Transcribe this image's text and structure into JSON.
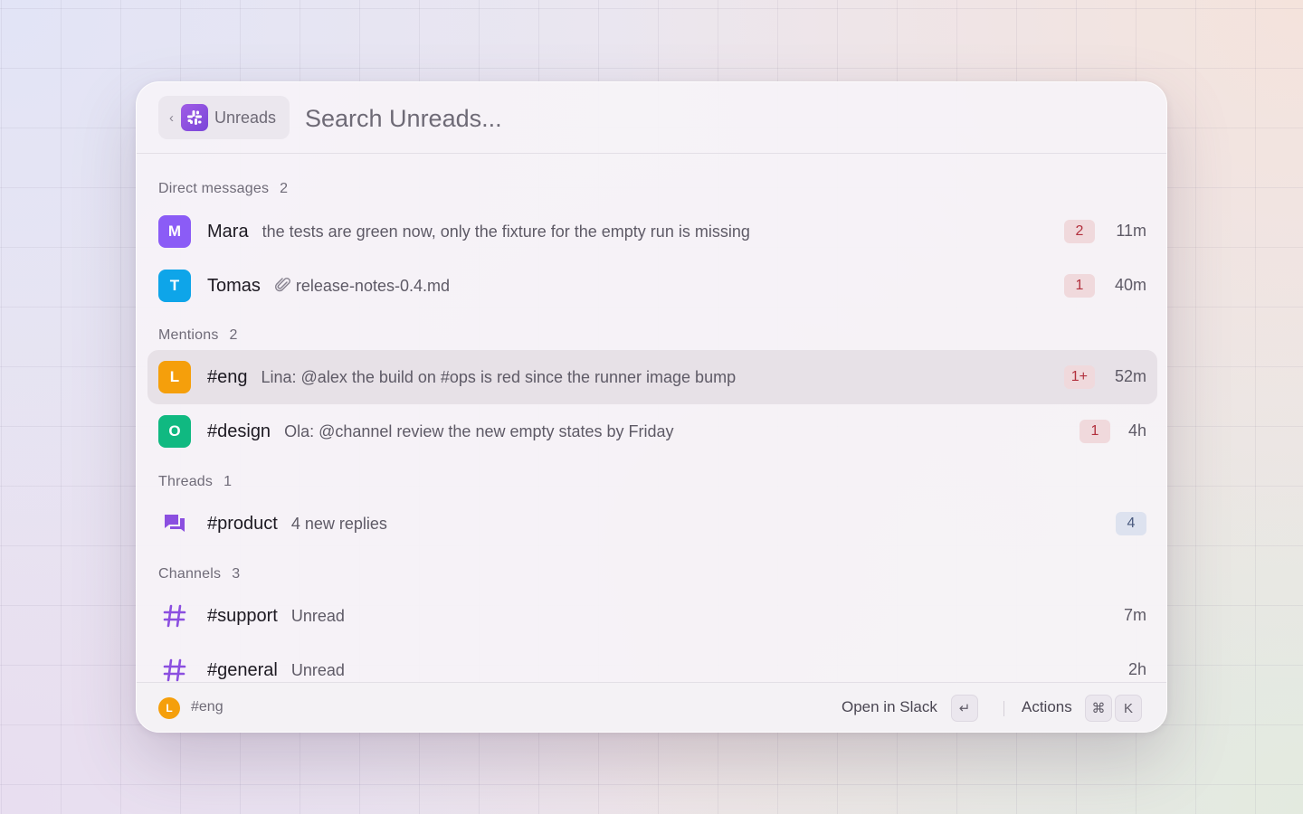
{
  "header": {
    "back_chevron": "‹",
    "context_label": "Unreads",
    "app_icon": "slack-logo",
    "search_placeholder": "Search Unreads..."
  },
  "sections": {
    "direct": {
      "label": "Direct messages",
      "count": "2"
    },
    "mentions": {
      "label": "Mentions",
      "count": "2"
    },
    "threads": {
      "label": "Threads",
      "count": "1"
    },
    "channels": {
      "label": "Channels",
      "count": "3"
    }
  },
  "rows": {
    "mara": {
      "initial": "M",
      "color": "#8b5cf6",
      "title": "Mara",
      "subtitle": "the tests are green now, only the fixture for the empty run is missing",
      "badge": "2",
      "time": "11m"
    },
    "tomas": {
      "initial": "T",
      "color": "#0ea5e9",
      "title": "Tomas",
      "icon": "paperclip-icon",
      "subtitle": "release-notes-0.4.md",
      "badge": "1",
      "time": "40m"
    },
    "eng": {
      "initial": "L",
      "color": "#f59f0b",
      "title": "#eng",
      "subtitle": "Lina: @alex the build on #ops is red since the runner image bump",
      "badge": "1+",
      "time": "52m"
    },
    "design": {
      "initial": "O",
      "color": "#10b981",
      "title": "#design",
      "subtitle": "Ola: @channel review the new empty states by Friday",
      "badge": "1",
      "time": "4h"
    },
    "product": {
      "icon": "thread-icon",
      "title": "#product",
      "subtitle": "4 new replies",
      "badge": "4"
    },
    "support": {
      "icon": "hashtag-icon",
      "title": "#support",
      "subtitle": "Unread",
      "time": "7m"
    },
    "general": {
      "icon": "hashtag-icon",
      "title": "#general",
      "subtitle": "Unread",
      "time": "2h"
    }
  },
  "footer": {
    "selected_initial": "L",
    "selected_label": "#eng",
    "primary_action": "Open in Slack",
    "primary_key": "↵",
    "secondary_action": "Actions",
    "secondary_keys": [
      "⌘",
      "K"
    ]
  },
  "colors": {
    "accent_purple": "#8b4fe0",
    "badge_red_bg": "#f0d9dc",
    "badge_red_text": "#b2303d",
    "badge_blue_bg": "#dde2ef",
    "selection_bg": "#e7e1e7"
  }
}
